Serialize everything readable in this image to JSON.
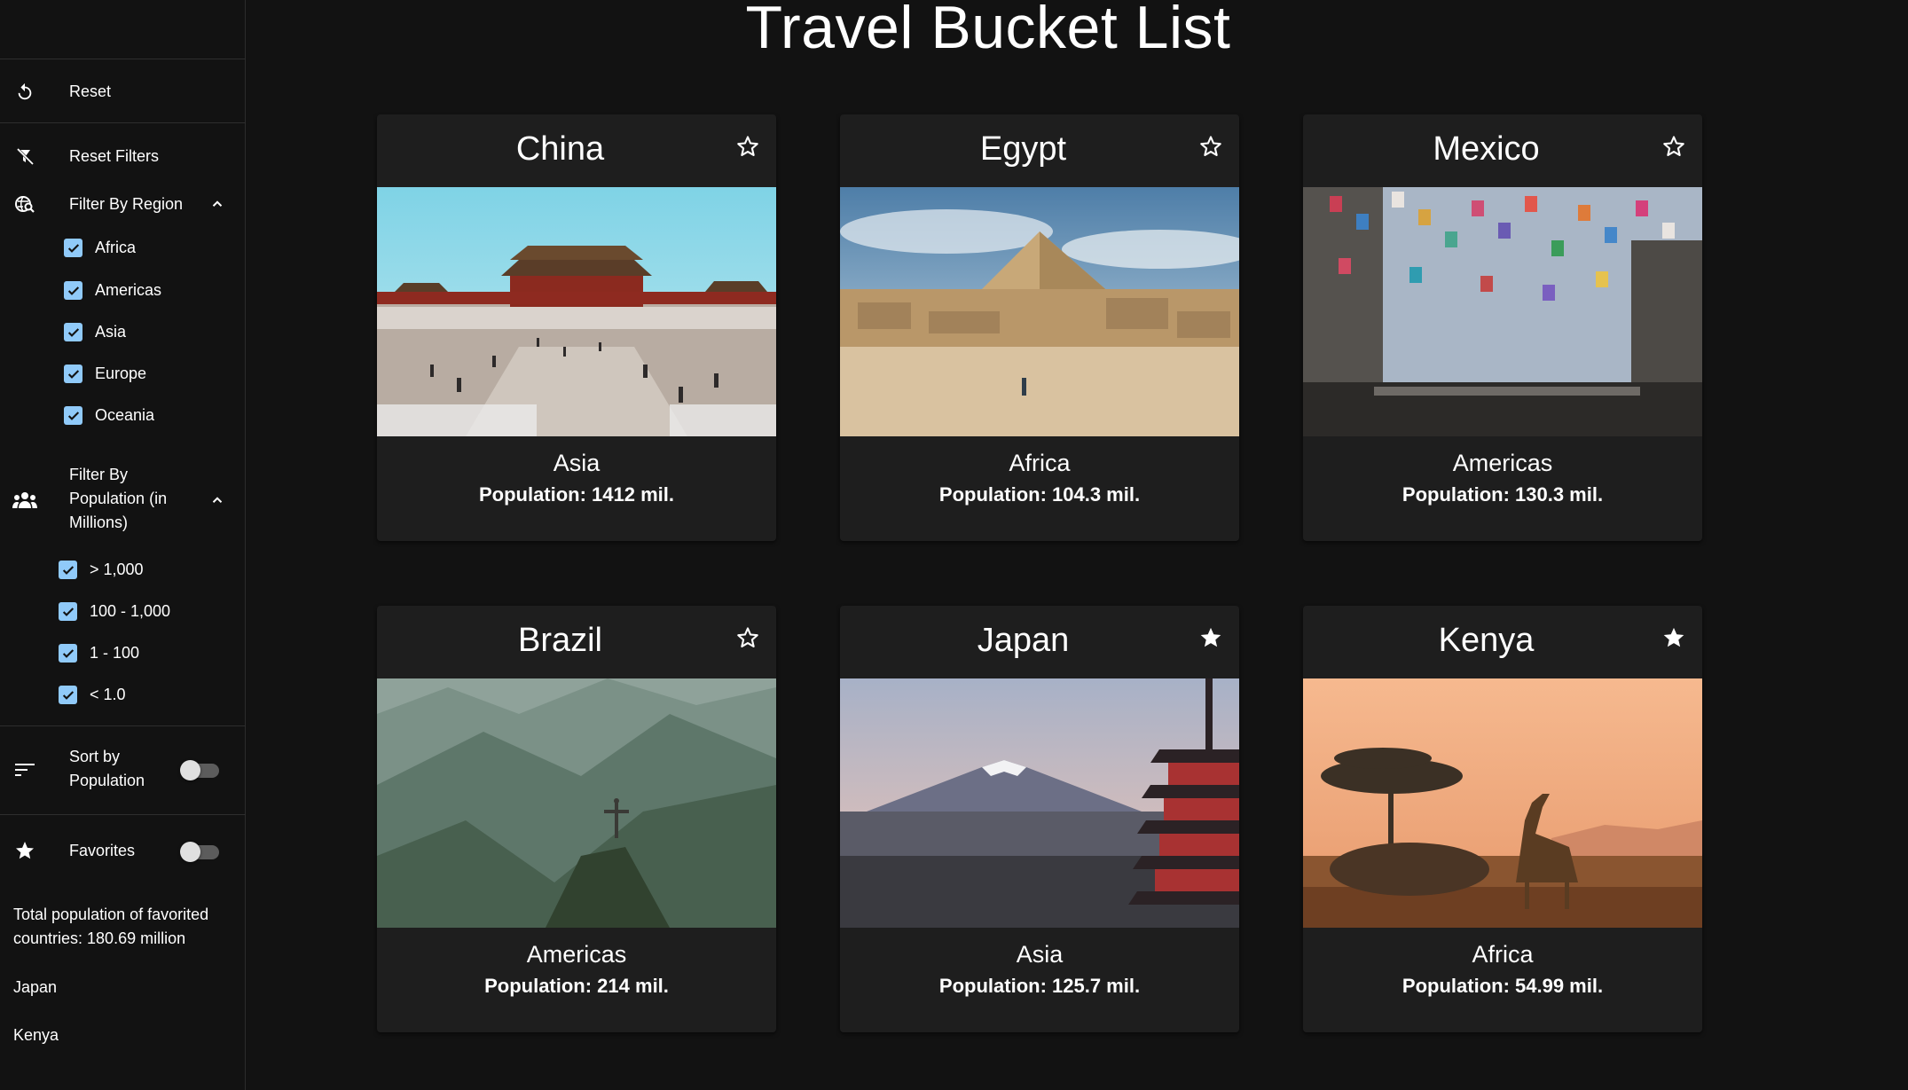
{
  "app": {
    "title": "Travel Bucket List"
  },
  "sidebar": {
    "reset_label": "Reset",
    "reset_filters_label": "Reset Filters",
    "region_filter": {
      "label": "Filter By Region",
      "options": [
        {
          "label": "Africa",
          "checked": true
        },
        {
          "label": "Americas",
          "checked": true
        },
        {
          "label": "Asia",
          "checked": true
        },
        {
          "label": "Europe",
          "checked": true
        },
        {
          "label": "Oceania",
          "checked": true
        }
      ]
    },
    "population_filter": {
      "label_line1": "Filter By",
      "label_line2": "Population (in",
      "label_line3": "Millions)",
      "options": [
        {
          "label": "> 1,000",
          "checked": true
        },
        {
          "label": "100 - 1,000",
          "checked": true
        },
        {
          "label": "1 - 100",
          "checked": true
        },
        {
          "label": "< 1.0",
          "checked": true
        }
      ]
    },
    "sort": {
      "label_line1": "Sort by",
      "label_line2": "Population",
      "enabled": false
    },
    "favorites": {
      "label": "Favorites",
      "enabled": false
    },
    "total_text_line1": "Total population of favorited",
    "total_text_line2": "countries: 180.69 million",
    "favorite_list": [
      "Japan",
      "Kenya"
    ]
  },
  "cards": [
    {
      "name": "China",
      "region": "Asia",
      "population": "Population: 1412 mil.",
      "favorite": false
    },
    {
      "name": "Egypt",
      "region": "Africa",
      "population": "Population: 104.3 mil.",
      "favorite": false
    },
    {
      "name": "Mexico",
      "region": "Americas",
      "population": "Population: 130.3 mil.",
      "favorite": false
    },
    {
      "name": "Brazil",
      "region": "Americas",
      "population": "Population: 214 mil.",
      "favorite": false
    },
    {
      "name": "Japan",
      "region": "Asia",
      "population": "Population: 125.7 mil.",
      "favorite": true
    },
    {
      "name": "Kenya",
      "region": "Africa",
      "population": "Population: 54.99 mil.",
      "favorite": true
    }
  ],
  "colors": {
    "background": "#121212",
    "card": "#1e1e1e",
    "checkbox": "#90caf9",
    "text": "#ffffff"
  }
}
